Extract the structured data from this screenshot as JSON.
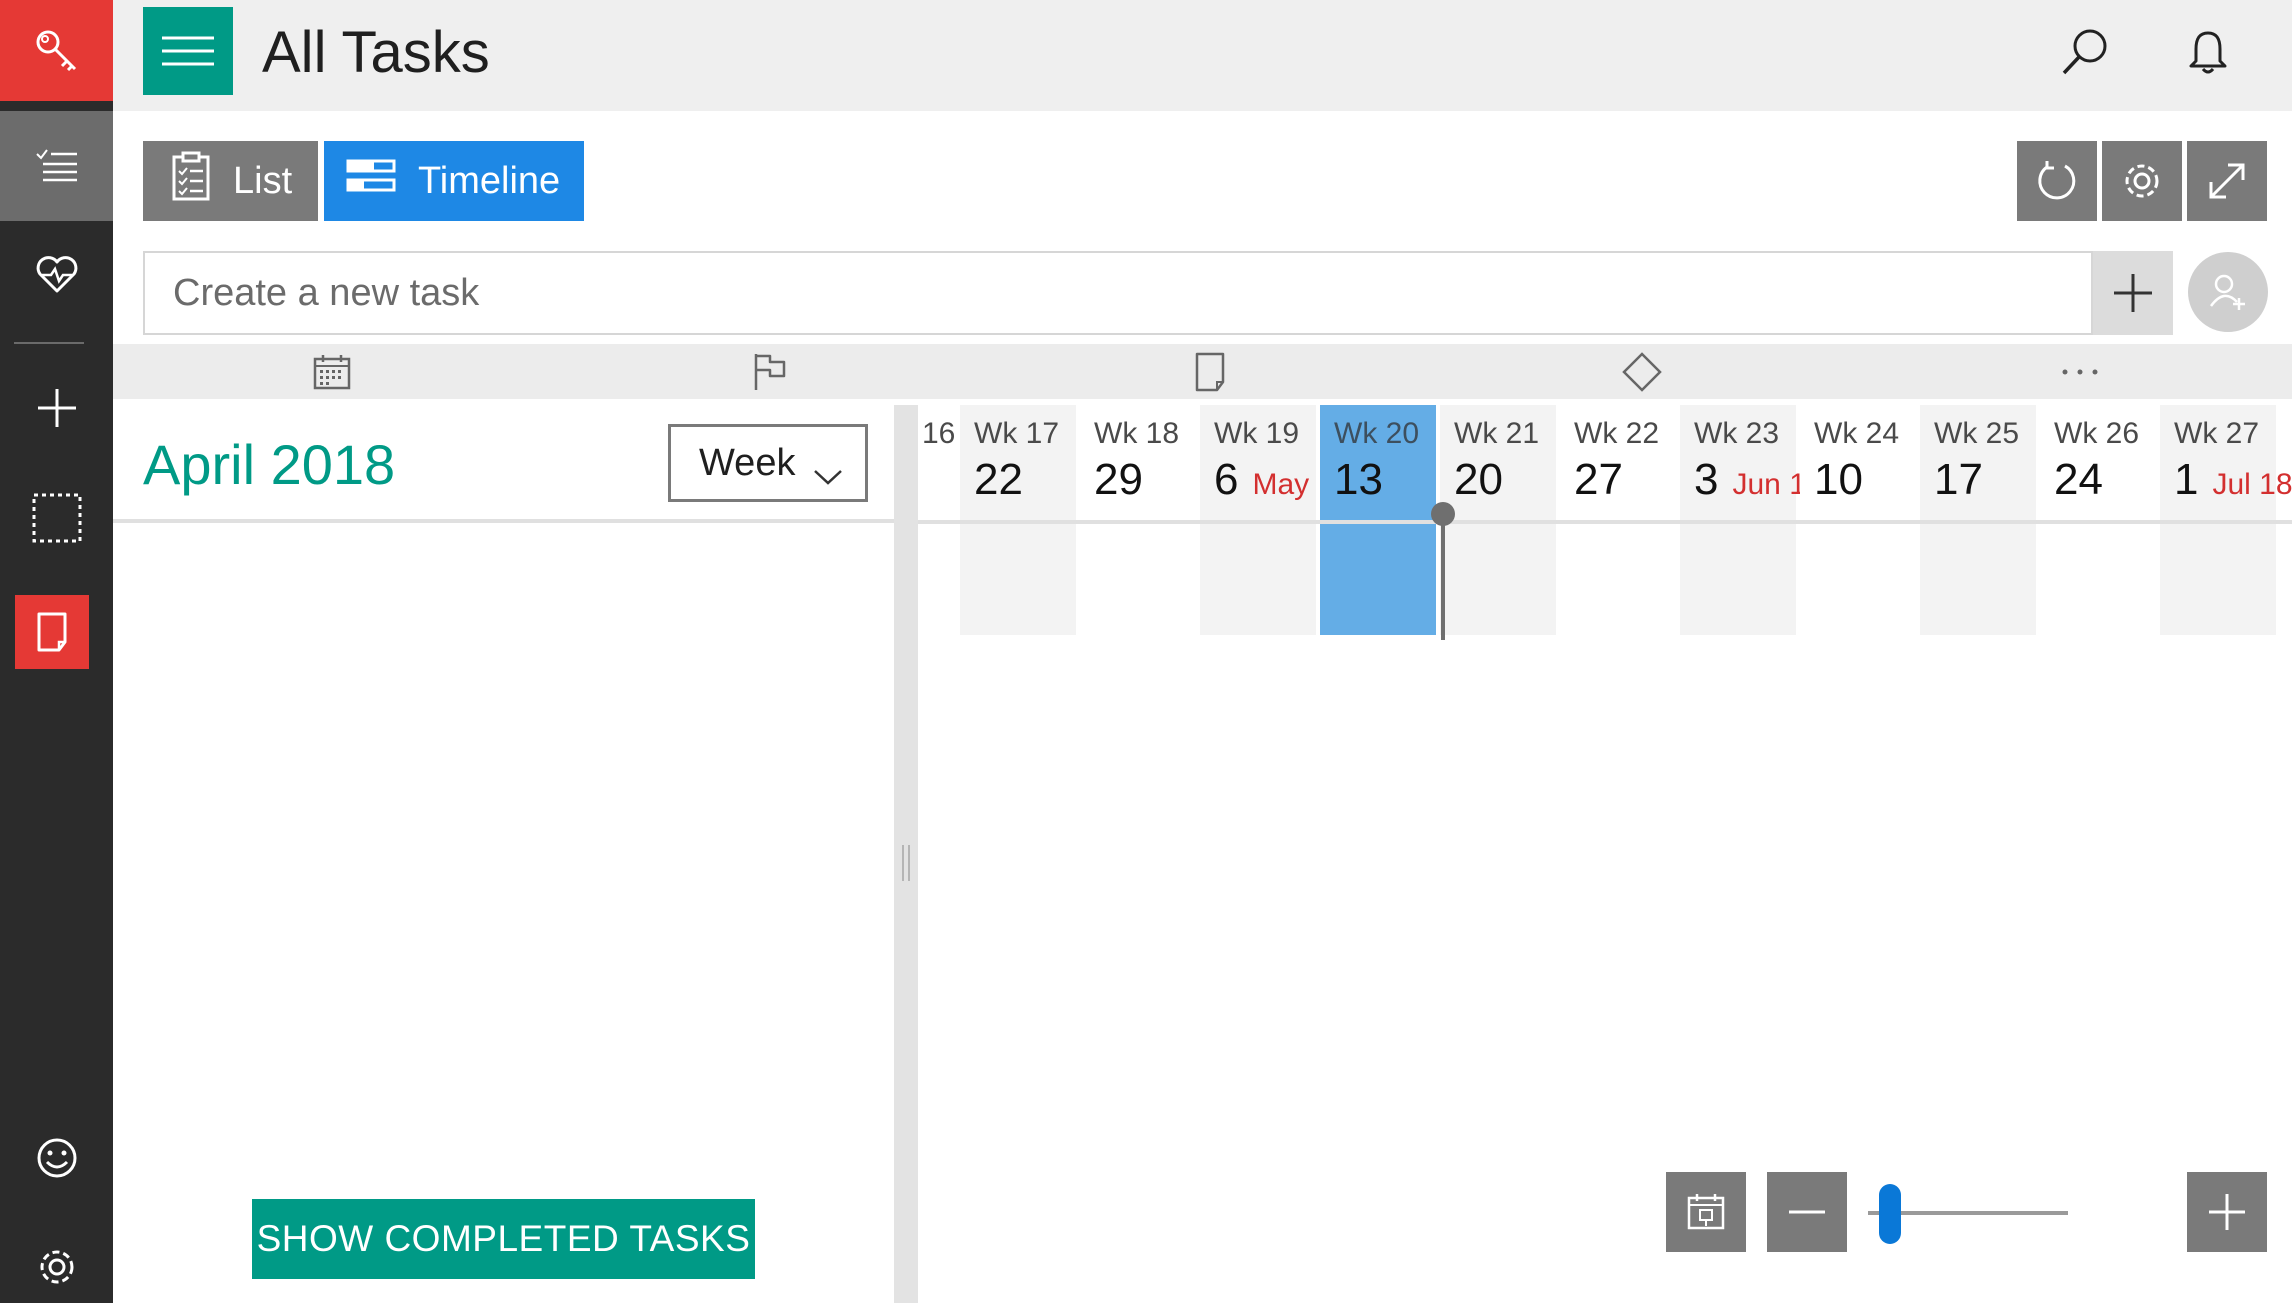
{
  "header": {
    "title": "All Tasks",
    "menu_icon": "hamburger-icon",
    "search_icon": "search-icon",
    "notifications_icon": "bell-icon"
  },
  "rail": {
    "items": [
      {
        "name": "key-icon",
        "active_color": "#e53935"
      },
      {
        "name": "task-list-icon",
        "selected": true
      },
      {
        "name": "heart-pulse-icon"
      },
      {
        "name": "add-icon"
      },
      {
        "name": "dotted-selection-icon"
      },
      {
        "name": "note-icon",
        "active_color": "#e53935"
      },
      {
        "name": "smiley-icon"
      },
      {
        "name": "gear-icon"
      }
    ]
  },
  "toolbar": {
    "list_label": "List",
    "timeline_label": "Timeline",
    "refresh_icon": "refresh-icon",
    "settings_icon": "gear-icon",
    "expand_icon": "expand-icon"
  },
  "task_input": {
    "placeholder": "Create a new task",
    "add_icon": "plus-icon",
    "assign_icon": "add-person-icon"
  },
  "columns": {
    "icons": [
      "calendar-icon",
      "flag-icon",
      "note-icon",
      "diamond-icon",
      "more-icon"
    ]
  },
  "timeline": {
    "month_label": "April 2018",
    "scale": "Week",
    "partial_week_label": "16",
    "weeks": [
      {
        "label": "Wk 17",
        "day": "22",
        "month": ""
      },
      {
        "label": "Wk 18",
        "day": "29",
        "month": ""
      },
      {
        "label": "Wk 19",
        "day": "6",
        "month": "May"
      },
      {
        "label": "Wk 20",
        "day": "13",
        "month": "",
        "current": true
      },
      {
        "label": "Wk 21",
        "day": "20",
        "month": ""
      },
      {
        "label": "Wk 22",
        "day": "27",
        "month": ""
      },
      {
        "label": "Wk 23",
        "day": "3",
        "month": "Jun 1"
      },
      {
        "label": "Wk 24",
        "day": "10",
        "month": ""
      },
      {
        "label": "Wk 25",
        "day": "17",
        "month": ""
      },
      {
        "label": "Wk 26",
        "day": "24",
        "month": ""
      },
      {
        "label": "Wk 27",
        "day": "1",
        "month": "Jul 18"
      }
    ],
    "show_completed_label": "SHOW COMPLETED TASKS"
  },
  "zoom": {
    "today_icon": "calendar-today-icon",
    "zoom_out_icon": "minus-icon",
    "zoom_in_icon": "plus-icon",
    "level": 0.08
  },
  "colors": {
    "accent": "#009a86",
    "selected_tab": "#1e88e5",
    "current_week": "#64ade6",
    "month_marker": "#d32f2f",
    "rail_bg": "#2b2b2b",
    "rail_alert": "#e53935"
  }
}
